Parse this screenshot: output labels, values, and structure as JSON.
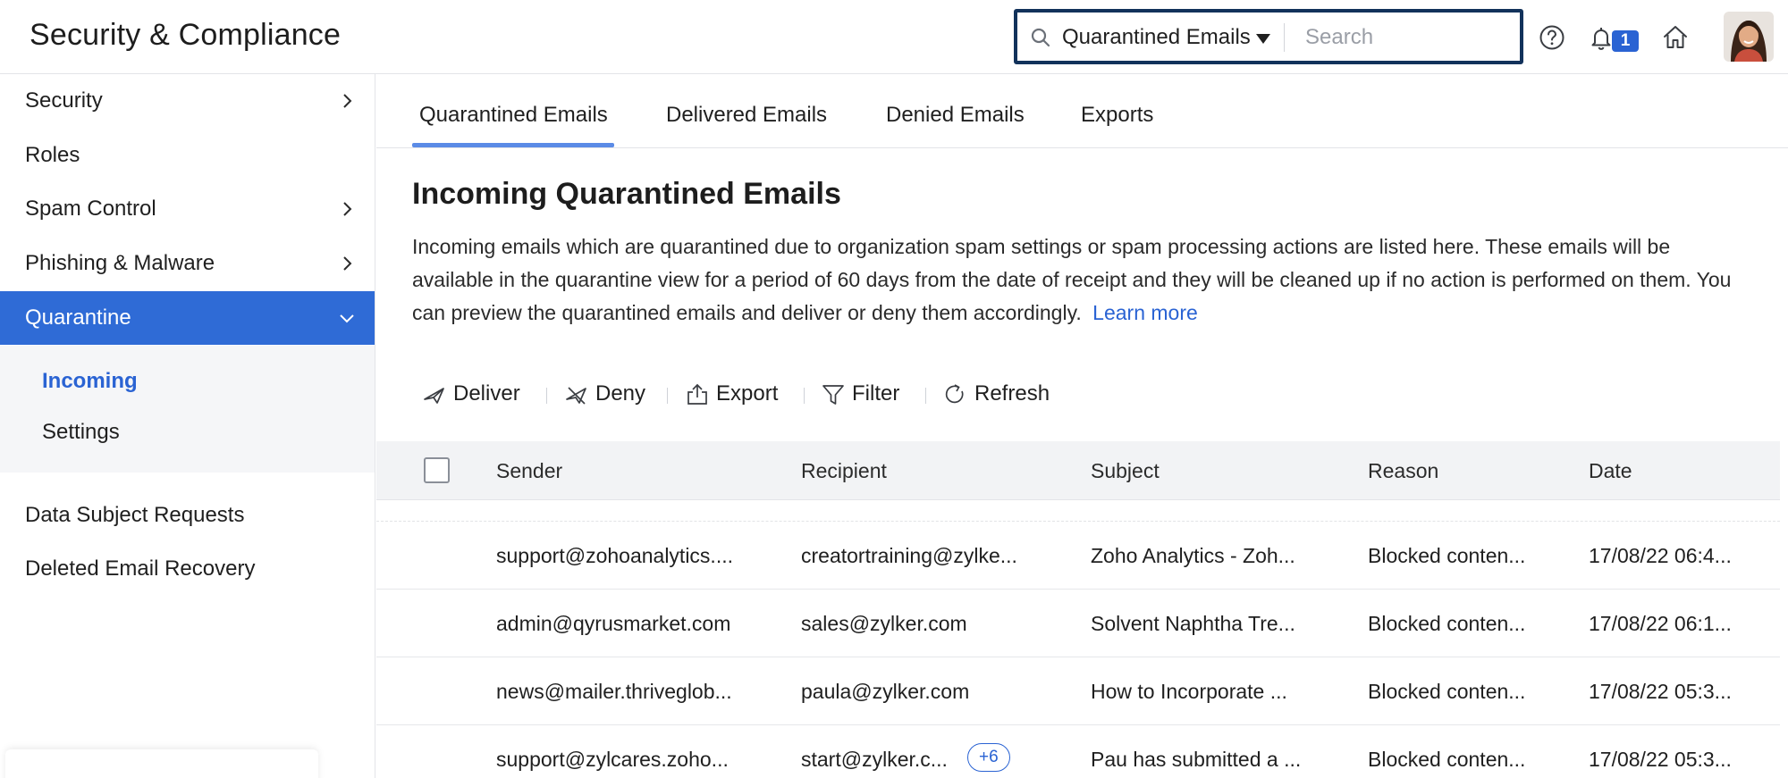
{
  "header": {
    "title": "Security & Compliance",
    "search_scope": "Quarantined Emails",
    "search_placeholder": "Search",
    "notification_count": "1"
  },
  "sidebar": {
    "items": [
      {
        "label": "Security"
      },
      {
        "label": "Roles"
      },
      {
        "label": "Spam Control"
      },
      {
        "label": "Phishing & Malware"
      },
      {
        "label": "Quarantine"
      },
      {
        "label": "Data Subject Requests"
      },
      {
        "label": "Deleted Email Recovery"
      }
    ],
    "submenu": [
      {
        "label": "Incoming"
      },
      {
        "label": "Settings"
      }
    ]
  },
  "tabs": [
    {
      "label": "Quarantined Emails"
    },
    {
      "label": "Delivered Emails"
    },
    {
      "label": "Denied Emails"
    },
    {
      "label": "Exports"
    }
  ],
  "main": {
    "title": "Incoming Quarantined Emails",
    "description": "Incoming emails which are quarantined due to organization spam settings or spam processing actions are listed here. These emails will be available in the quarantine view for a period of 60 days from the date of receipt and they will be cleaned up if no action is performed on them. You can preview the quarantined emails and deliver or deny them accordingly.",
    "learn_more": "Learn more"
  },
  "toolbar": {
    "deliver": "Deliver",
    "deny": "Deny",
    "export": "Export",
    "filter": "Filter",
    "refresh": "Refresh"
  },
  "table": {
    "columns": [
      "Sender",
      "Recipient",
      "Subject",
      "Reason",
      "Date"
    ],
    "rows": [
      {
        "sender": "support@zohoanalytics....",
        "recipient": "creatortraining@zylke...",
        "subject": "Zoho Analytics - Zoh...",
        "reason": "Blocked conten...",
        "date": "17/08/22 06:4..."
      },
      {
        "sender": "admin@qyrusmarket.com",
        "recipient": "sales@zylker.com",
        "subject": "Solvent Naphtha Tre...",
        "reason": "Blocked conten...",
        "date": "17/08/22 06:1..."
      },
      {
        "sender": "news@mailer.thriveglob...",
        "recipient": "paula@zylker.com",
        "subject": "How to Incorporate ...",
        "reason": "Blocked conten...",
        "date": "17/08/22 05:3..."
      },
      {
        "sender": "support@zylcares.zoho...",
        "recipient": "start@zylker.c...",
        "recipient_extra": "+6",
        "subject": "Pau has submitted a ...",
        "reason": "Blocked conten...",
        "date": "17/08/22 05:3..."
      }
    ]
  }
}
